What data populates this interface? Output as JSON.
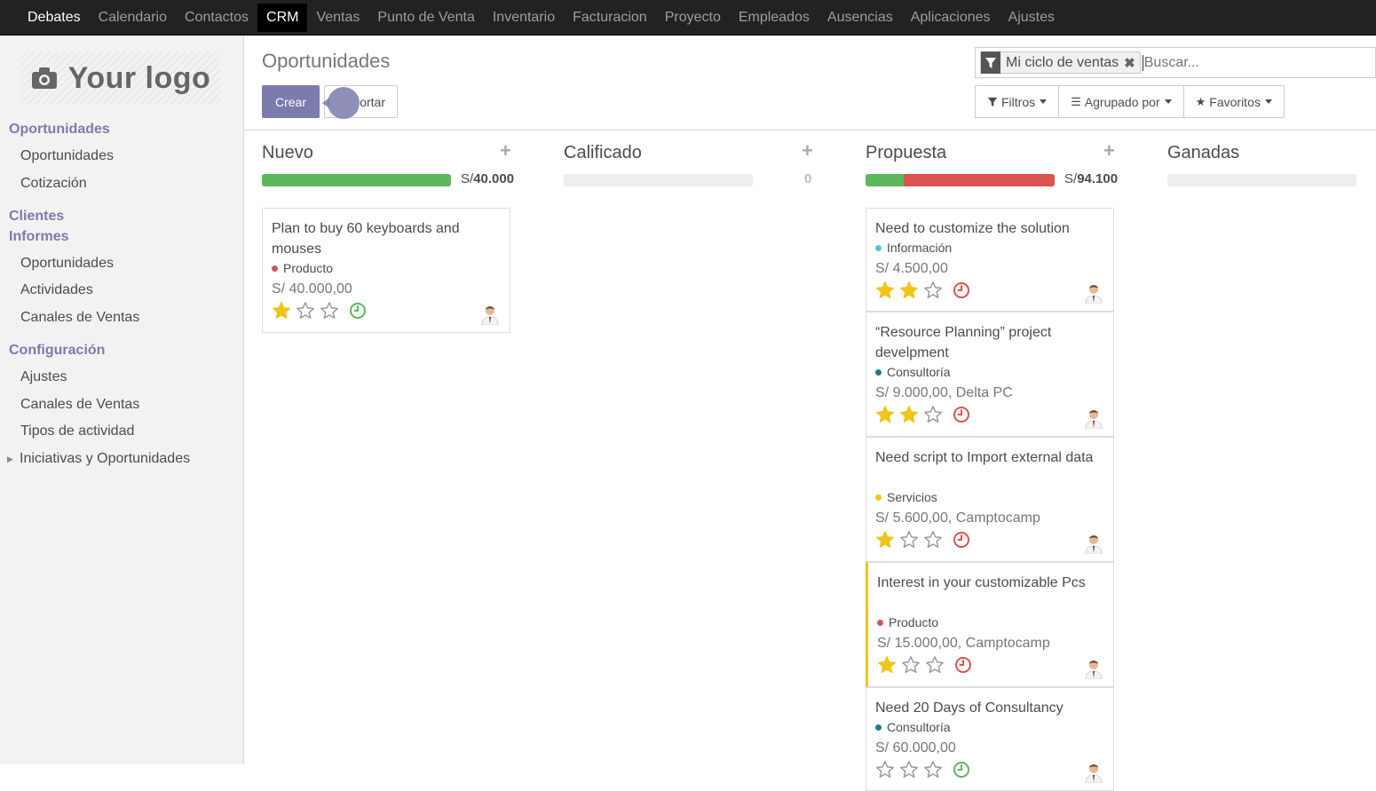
{
  "nav": [
    "Debates",
    "Calendario",
    "Contactos",
    "CRM",
    "Ventas",
    "Punto de Venta",
    "Inventario",
    "Facturacion",
    "Proyecto",
    "Empleados",
    "Ausencias",
    "Aplicaciones",
    "Ajustes"
  ],
  "logo": {
    "text": "Your logo"
  },
  "sidebar": {
    "sections": [
      {
        "label": "Oportunidades",
        "items": [
          "Oportunidades",
          "Cotización"
        ]
      },
      {
        "label": "Clientes",
        "items": []
      },
      {
        "label": "Informes",
        "items": [
          "Oportunidades",
          "Actividades",
          "Canales de Ventas"
        ]
      },
      {
        "label": "Configuración",
        "items": [
          "Ajustes",
          "Canales de Ventas",
          "Tipos de actividad",
          "Iniciativas y Oportunidades"
        ]
      }
    ]
  },
  "control": {
    "title": "Oportunidades",
    "create_label": "Crear",
    "import_label": "ortar",
    "facet_label": "Mi ciclo de ventas",
    "search_placeholder": "Buscar...",
    "filters_label": "Filtros",
    "groupby_label": "Agrupado por",
    "favorites_label": "Favoritos"
  },
  "colors": {
    "accent": "#7c7bad",
    "green": "#5cb85c",
    "red": "#d9534f",
    "star": "#f0c419",
    "grey": "#eeeeee"
  },
  "columns": [
    {
      "title": "Nuevo",
      "currency": "S/",
      "total": "40.000",
      "progress": [
        {
          "color": "#5cb85c",
          "fraction": 1.0
        }
      ],
      "cards": [
        {
          "title": "Plan to buy 60 keyboards and mouses",
          "tag": "Producto",
          "tag_color": "#d9534f",
          "amount": "S/ 40.000,00",
          "stars": 1,
          "activity": "green"
        }
      ]
    },
    {
      "title": "Calificado",
      "currency": "",
      "total": "0",
      "progress": [],
      "cards": []
    },
    {
      "title": "Propuesta",
      "currency": "S/",
      "total": "94.100",
      "progress": [
        {
          "color": "#5cb85c",
          "fraction": 0.2
        },
        {
          "color": "#d9534f",
          "fraction": 0.8
        }
      ],
      "cards": [
        {
          "title": "Need to customize the solution",
          "tag": "Información",
          "tag_color": "#5bc0de",
          "amount": "S/ 4.500,00",
          "stars": 2,
          "activity": "red"
        },
        {
          "title": "“Resource Planning” project develpment",
          "tag": "Consultoría",
          "tag_color": "#1f7a8c",
          "amount": "S/ 9.000,00, Delta PC",
          "stars": 2,
          "activity": "red"
        },
        {
          "title": "Need script to Import external data",
          "tag": "Servicios",
          "tag_color": "#f0c419",
          "amount": "S/ 5.600,00, Camptocamp",
          "stars": 1,
          "activity": "red"
        },
        {
          "title": "Interest in your customizable Pcs",
          "tag": "Producto",
          "tag_color": "#d9534f",
          "amount": "S/ 15.000,00, Camptocamp",
          "stars": 1,
          "activity": "red",
          "highlight": true
        },
        {
          "title": "Need 20 Days of Consultancy",
          "tag": "Consultoría",
          "tag_color": "#1f7a8c",
          "amount": "S/ 60.000,00",
          "stars": 0,
          "activity": "green"
        }
      ]
    },
    {
      "title": "Ganadas",
      "currency": "",
      "total": "",
      "progress": [],
      "cards": []
    }
  ]
}
